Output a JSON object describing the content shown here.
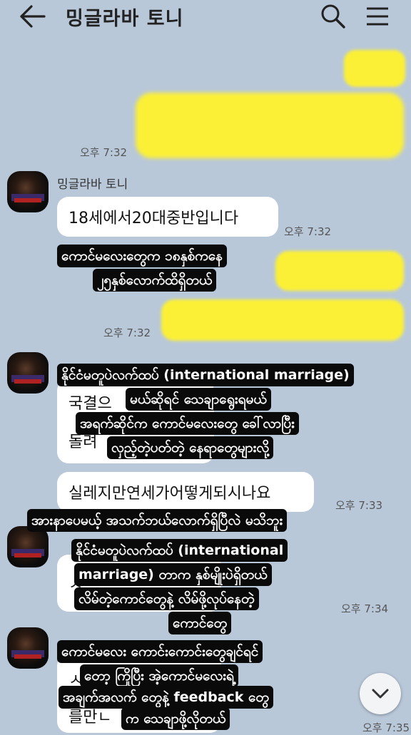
{
  "header": {
    "title": "밍글라바 토니",
    "icons": [
      "back-arrow-icon",
      "search-icon",
      "hamburger-menu-icon"
    ]
  },
  "chat": {
    "sender_name": "밍글라바 토니",
    "times": {
      "t1": "오후 7:32",
      "t2": "오후 7:32",
      "t3": "오후 7:32",
      "t4": "오후 7:33",
      "t5": "오후 7:34",
      "t6": "오후 7:35"
    },
    "messages": {
      "m1": "18세에서20대중반입니다",
      "m2": "국결으",
      "m3": "돌려",
      "m4": "실레지만연세가어떻게되시나요",
      "m5": "ㅅ",
      "m6": "ㅅ",
      "m7": "를만ㄴ"
    }
  },
  "captions": {
    "c1_l1": "ကောင်မလေးတွေက ၁၈နှစ်ကနေ",
    "c1_l2": "၂၅နှစ်လောက်ထိရှိတယ်",
    "c2_l1": "နိုင်ငံမတူပဲလက်ထပ် (international marriage)",
    "c2_l2": "မယ်ဆိုရင် သေချာရွေးရမယ်",
    "c2_l3": "အရက်ဆိုင်က ကောင်မလေးတွေ ခေါ်လာပြီး",
    "c2_l4": "လှည့်တဲ့ပတ်တဲ့ နေရာတွေများလို့",
    "c3_l1": "အားနာပေမယ့် အသက်ဘယ်လောက်ရှိပြီလဲ မသိဘူး",
    "c4_l1": "နိုင်ငံမတူပဲလက်ထပ် (international",
    "c4_l2": "marriage) တာက နှစ်မျိုးပဲရှိတယ်",
    "c4_l3": "လိမ်တဲ့ကောင်တွေနဲ့ လိမ်ဖို့လုပ်နေတဲ့",
    "c4_l4": "ကောင်တွေ",
    "c5_l1": "ကောင်မလေး ကောင်းကောင်းတွေချင်ရင်",
    "c5_l2": "တော့ ကြိုပြီး အဲ့ကောင်မလေးရဲ့",
    "c5_l3": "အချက်အလက် တွေနဲ့ feedback တွေ",
    "c5_l4": "က သေချာဖို့လိုတယ်"
  },
  "colors": {
    "background": "#b9c8d9",
    "my_bubble": "#fbf036",
    "their_bubble": "#ffffff",
    "caption_bg": "#0a0a0a"
  }
}
